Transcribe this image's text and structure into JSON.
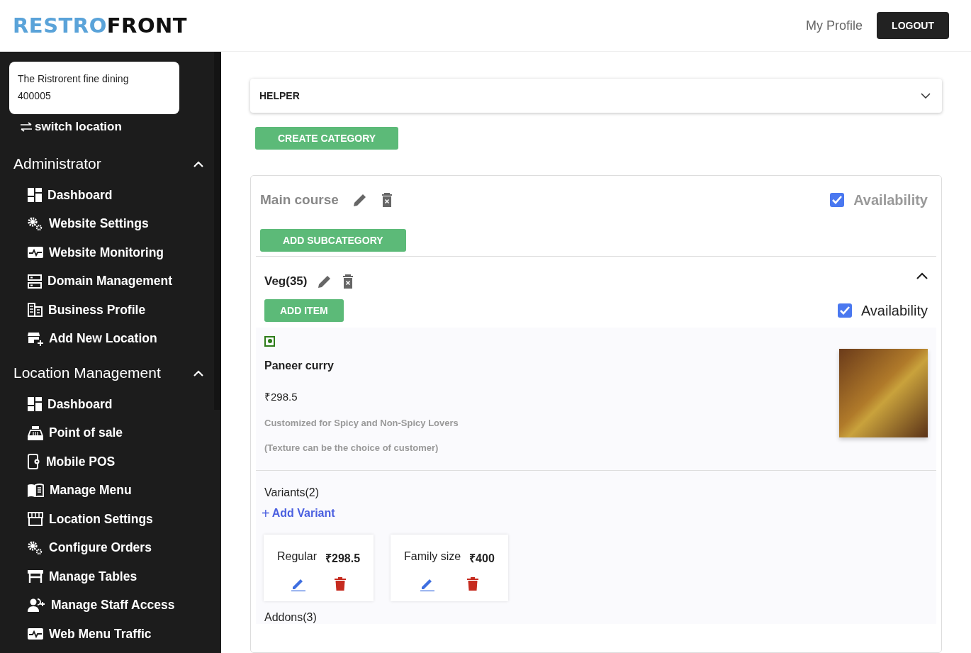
{
  "header": {
    "logo": [
      "RESTRO",
      "FRONT"
    ],
    "profile_link": "My Profile",
    "logout_button": "LOGOUT"
  },
  "sidebar": {
    "location": {
      "name": "The Ristrorent fine dining",
      "code": "400005"
    },
    "switch_location": "switch location",
    "sections": [
      {
        "title": "Administrator",
        "expanded": true,
        "items": [
          "Dashboard",
          "Website Settings",
          "Website Monitoring",
          "Domain Management",
          "Business Profile",
          "Add New Location"
        ]
      },
      {
        "title": "Location Management",
        "expanded": true,
        "items": [
          "Dashboard",
          "Point of sale",
          "Mobile POS",
          "Manage Menu",
          "Location Settings",
          "Configure Orders",
          "Manage Tables",
          "Manage Staff Access",
          "Web Menu Traffic"
        ]
      }
    ]
  },
  "helper": {
    "title": "HELPER",
    "expanded": false
  },
  "create_category_button": "CREATE CATEGORY",
  "category": {
    "name": "Main course",
    "availability": {
      "label": "Availability",
      "checked": true
    },
    "add_subcategory_button": "ADD SUBCATEGORY",
    "subcategory": {
      "name": "Veg(35)",
      "expanded": true,
      "add_item_button": "ADD ITEM",
      "availability": {
        "label": "Availability",
        "checked": true
      },
      "item": {
        "kind": "veg",
        "name": "Paneer curry",
        "price": "₹298.5",
        "description": [
          "Customized for Spicy and Non-Spicy Lovers",
          "(Texture can be the choice of customer)"
        ],
        "variants_title": "Variants(2)",
        "add_variant": {
          "icon": "+",
          "label": "Add Variant"
        },
        "variants": [
          {
            "name": "Regular",
            "price": "₹298.5"
          },
          {
            "name": "Family size",
            "price": "₹400"
          }
        ],
        "addons_title": "Addons(3)"
      }
    }
  }
}
